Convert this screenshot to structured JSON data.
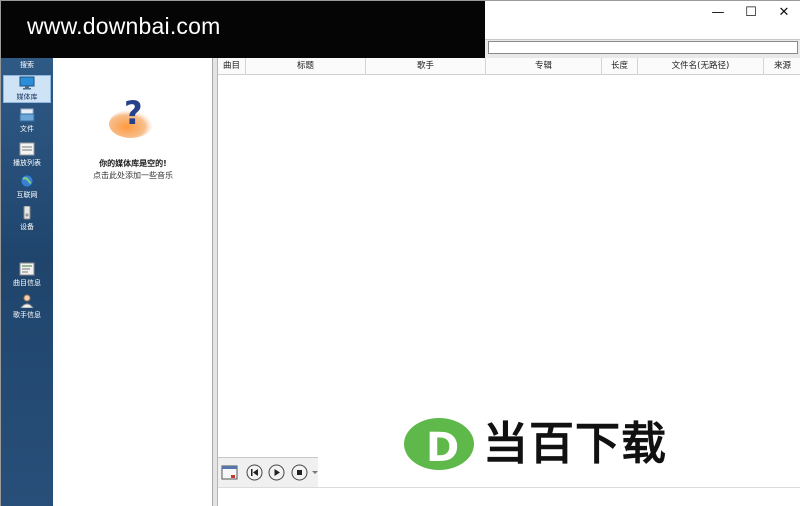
{
  "watermark": {
    "text": "www.downbai.com"
  },
  "window": {
    "minimize": "—",
    "maximize": "☐",
    "close": "✕"
  },
  "nav": {
    "items": [
      {
        "label": "搜索",
        "icon": "search-icon"
      },
      {
        "label": "媒体库",
        "icon": "media-library-icon",
        "active": true
      },
      {
        "label": "文件",
        "icon": "file-icon"
      },
      {
        "label": "播放列表",
        "icon": "playlist-icon"
      },
      {
        "label": "互联网",
        "icon": "globe-icon"
      },
      {
        "label": "设备",
        "icon": "device-icon"
      },
      {
        "label": "曲目信息",
        "icon": "track-info-icon"
      },
      {
        "label": "歌手信息",
        "icon": "artist-info-icon"
      }
    ]
  },
  "library": {
    "empty_title": "你的媒体库是空的!",
    "empty_sub": "点击此处添加一些音乐"
  },
  "table": {
    "columns": [
      "曲目",
      "标题",
      "歌手",
      "专辑",
      "长度",
      "文件名(无路径)",
      "来源"
    ]
  },
  "player": {
    "buttons": [
      "window-icon",
      "previous-icon",
      "play-icon",
      "stop-icon",
      "dropdown-icon"
    ]
  },
  "brand": {
    "text": "当百下载",
    "letter": "D"
  },
  "colors": {
    "nav": "#284f79",
    "brand_green": "#5fb84a",
    "brand_dark": "#111111"
  }
}
